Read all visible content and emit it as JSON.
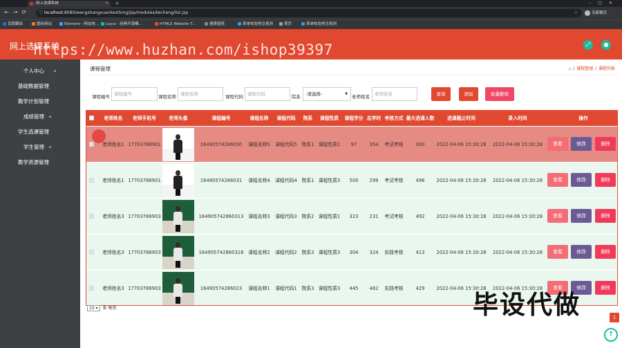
{
  "browser": {
    "tab_title": "网上选课系统",
    "url_host": "localhost",
    "url_path": ":8080/wangshangxuankexitong/jsp/modules/kecheng/list.jsp",
    "profile": "无痕模式",
    "bookmarks": [
      {
        "label": "百度翻译",
        "color": "#2b6dd6"
      },
      {
        "label": "图标网站",
        "color": "#e67e22"
      },
      {
        "label": "Element - 网站快...",
        "color": "#409eff"
      },
      {
        "label": "Layui - 经典开源模...",
        "color": "#16baaa"
      },
      {
        "label": "HTML5 Website T...",
        "color": "#e44d26"
      },
      {
        "label": "搜索壁纸",
        "color": "#7f8c8d"
      },
      {
        "label": "表单校验常见规则",
        "color": "#3498db"
      },
      {
        "label": "首页",
        "color": "#95a5a6"
      },
      {
        "label": "表单校验常见规则",
        "color": "#3498db"
      }
    ]
  },
  "app": {
    "title": "网上选课系统",
    "watermark_url": "https://www.huzhan.com/ishop39397",
    "watermark_text": "毕设代做",
    "accent": "#e0482f"
  },
  "sidebar": {
    "items": [
      {
        "label": "个人中心"
      },
      {
        "label": "基础数据管理"
      },
      {
        "label": "教学计划管理"
      },
      {
        "label": "成绩管理"
      },
      {
        "label": "学生选课管理"
      },
      {
        "label": "学生管理"
      },
      {
        "label": "教学资源管理"
      }
    ]
  },
  "page": {
    "title": "课程管理",
    "breadcrumb": [
      "课程管理",
      "课程列表"
    ]
  },
  "filters": {
    "course_no_label": "课程编号",
    "course_no_placeholder": "课程编号",
    "course_name_label": "课程名称",
    "course_name_placeholder": "课程名称",
    "course_code_label": "课程代码",
    "course_code_placeholder": "课程代码",
    "dept_label": "院系",
    "dept_value": "-请选择-",
    "teacher_label": "老师姓名",
    "teacher_placeholder": "老师姓名",
    "query_btn": "查询",
    "add_btn": "添加",
    "batch_delete_btn": "批量删除"
  },
  "table": {
    "headers": [
      "老师姓名",
      "老师手机号",
      "老师头像",
      "课程编号",
      "课程名称",
      "课程代码",
      "院系",
      "课程性质",
      "课程学分",
      "总学时",
      "考核方式",
      "最大选课人数",
      "选课截止时间",
      "录入时间",
      "操作"
    ],
    "rows": [
      {
        "teacher": "老师姓名1",
        "phone": "17703786901",
        "course_no": "16490574286030",
        "course_name": "课程名称5",
        "course_code": "课程代码5",
        "dept": "院系1",
        "nature": "课程性质1",
        "credit": "97",
        "hours": "354",
        "exam": "考试考核",
        "max": "300",
        "deadline": "2022-04-06 15:30:28",
        "created": "2022-04-06 15:30:28"
      },
      {
        "teacher": "老师姓名1",
        "phone": "17703786901",
        "course_no": "16490574286031",
        "course_name": "课程名称4",
        "course_code": "课程代码4",
        "dept": "院系1",
        "nature": "课程性质3",
        "credit": "500",
        "hours": "299",
        "exam": "考试考核",
        "max": "496",
        "deadline": "2022-04-06 15:30:28",
        "created": "2022-04-06 15:30:28"
      },
      {
        "teacher": "老师姓名3",
        "phone": "17703786903",
        "course_no": "164905742860313",
        "course_name": "课程名称3",
        "course_code": "课程代码3",
        "dept": "院系2",
        "nature": "课程性质1",
        "credit": "323",
        "hours": "231",
        "exam": "考试考核",
        "max": "492",
        "deadline": "2022-04-06 15:30:28",
        "created": "2022-04-06 15:30:28"
      },
      {
        "teacher": "老师姓名3",
        "phone": "17703786903",
        "course_no": "164905742860318",
        "course_name": "课程名称2",
        "course_code": "课程代码2",
        "dept": "院系3",
        "nature": "课程性质3",
        "credit": "304",
        "hours": "324",
        "exam": "实践考核",
        "max": "413",
        "deadline": "2022-04-06 15:30:28",
        "created": "2022-04-06 15:30:28"
      },
      {
        "teacher": "老师姓名3",
        "phone": "17703786903",
        "course_no": "16490574286023",
        "course_name": "课程名称1",
        "course_code": "课程代码1",
        "dept": "院系3",
        "nature": "课程性质3",
        "credit": "445",
        "hours": "482",
        "exam": "实践考核",
        "max": "429",
        "deadline": "2022-04-06 15:30:28",
        "created": "2022-04-06 15:30:28"
      }
    ],
    "view_btn": "查看",
    "edit_btn": "修改",
    "delete_btn": "删除"
  },
  "pager": {
    "page_size": "10",
    "page_size_suffix": "条 每页",
    "current_page": "1"
  }
}
